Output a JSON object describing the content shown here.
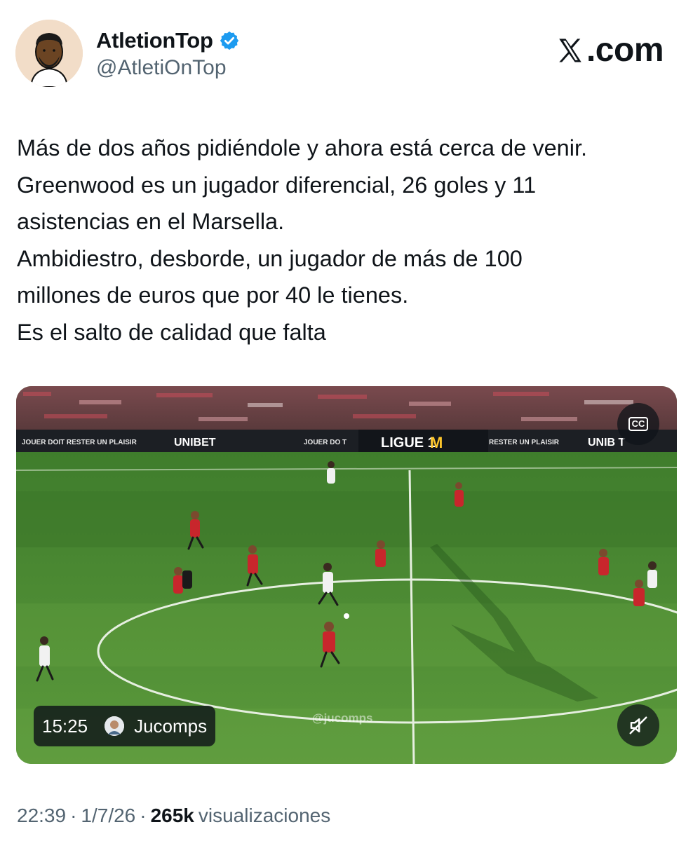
{
  "author": {
    "display_name": "AtletionTop",
    "handle": "@AtletiOnTop",
    "verified": true,
    "avatar_icon": "cartoon-man-avatar"
  },
  "brand": {
    "label": ".com",
    "icon": "x-logo-icon"
  },
  "tweet": {
    "lines": [
      "Más de dos años pidiéndole y ahora está cerca de venir.",
      "Greenwood es un jugador diferencial, 26 goles y 11",
      "asistencias en el Marsella.",
      "Ambidiestro, desborde, un jugador de más de 100",
      "millones de euros que por 40 le tienes.",
      "Es el salto de calidad que falta"
    ]
  },
  "video": {
    "duration": "15:25",
    "source_name": "Jucomps",
    "watermark": "@jucomps",
    "captions_icon": "cc-icon",
    "mute_icon": "speaker-muted-icon",
    "boards": {
      "left_slogan": "JOUER DOIT RESTER UN PLAISIR",
      "left_brand": "UNIBET",
      "center_slogan": "JOUER DO T",
      "center_brand": "LIGUE 1",
      "right_slogan": "RESTER UN PLAISIR",
      "right_brand": "UNIB T"
    }
  },
  "meta": {
    "time": "22:39",
    "date": "1/7/26",
    "separator": "·",
    "views_count": "265k",
    "views_label": "visualizaciones"
  },
  "colors": {
    "text_primary": "#0f1419",
    "text_secondary": "#536471",
    "verified_blue": "#1d9bf0",
    "pitch_green": "#4b8a33"
  }
}
